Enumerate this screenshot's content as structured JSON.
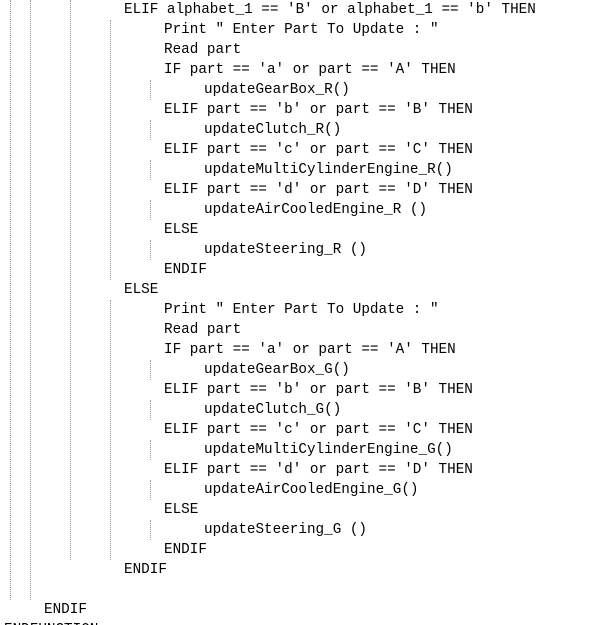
{
  "code": {
    "lines": [
      {
        "indent": 3,
        "text": "ELIF alphabet_1 == 'B' or alphabet_1 == 'b' THEN"
      },
      {
        "indent": 4,
        "text": "Print \" Enter Part To Update : \""
      },
      {
        "indent": 4,
        "text": "Read part"
      },
      {
        "indent": 4,
        "text": "IF part == 'a' or part == 'A' THEN"
      },
      {
        "indent": 5,
        "text": "updateGearBox_R()"
      },
      {
        "indent": 4,
        "text": "ELIF part == 'b' or part == 'B' THEN"
      },
      {
        "indent": 5,
        "text": "updateClutch_R()"
      },
      {
        "indent": 4,
        "text": "ELIF part == 'c' or part == 'C' THEN"
      },
      {
        "indent": 5,
        "text": "updateMultiCylinderEngine_R()"
      },
      {
        "indent": 4,
        "text": "ELIF part == 'd' or part == 'D' THEN"
      },
      {
        "indent": 5,
        "text": "updateAirCooledEngine_R ()"
      },
      {
        "indent": 4,
        "text": "ELSE"
      },
      {
        "indent": 5,
        "text": "updateSteering_R ()"
      },
      {
        "indent": 4,
        "text": "ENDIF"
      },
      {
        "indent": 3,
        "text": "ELSE"
      },
      {
        "indent": 4,
        "text": "Print \" Enter Part To Update : \""
      },
      {
        "indent": 4,
        "text": "Read part"
      },
      {
        "indent": 4,
        "text": "IF part == 'a' or part == 'A' THEN"
      },
      {
        "indent": 5,
        "text": "updateGearBox_G()"
      },
      {
        "indent": 4,
        "text": "ELIF part == 'b' or part == 'B' THEN"
      },
      {
        "indent": 5,
        "text": "updateClutch_G()"
      },
      {
        "indent": 4,
        "text": "ELIF part == 'c' or part == 'C' THEN"
      },
      {
        "indent": 5,
        "text": "updateMultiCylinderEngine_G()"
      },
      {
        "indent": 4,
        "text": "ELIF part == 'd' or part == 'D' THEN"
      },
      {
        "indent": 5,
        "text": "updateAirCooledEngine_G()"
      },
      {
        "indent": 4,
        "text": "ELSE"
      },
      {
        "indent": 5,
        "text": "updateSteering_G ()"
      },
      {
        "indent": 4,
        "text": "ENDIF"
      },
      {
        "indent": 3,
        "text": "ENDIF"
      },
      {
        "indent": 0,
        "text": ""
      },
      {
        "indent": 1,
        "text": "ENDIF"
      },
      {
        "indent": 0,
        "text": "ENDFUNCTION"
      }
    ]
  }
}
